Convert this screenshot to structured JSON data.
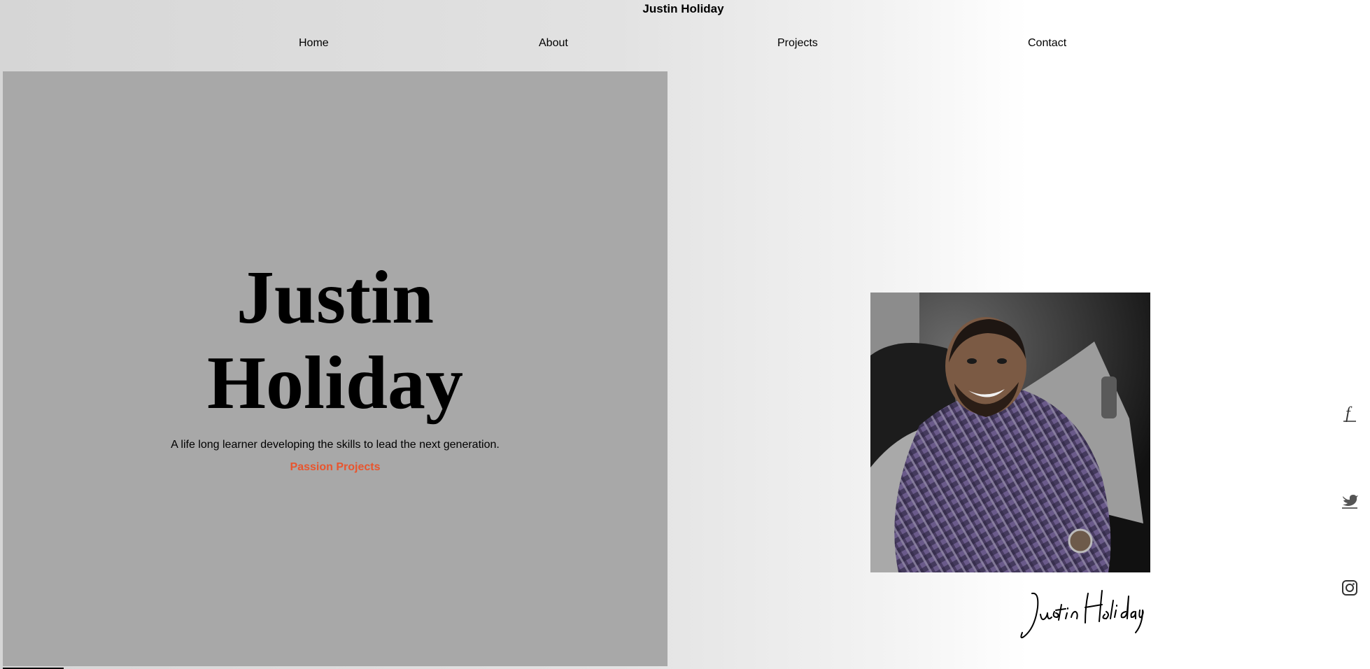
{
  "header": {
    "site_title": "Justin Holiday"
  },
  "nav": {
    "items": [
      {
        "label": "Home"
      },
      {
        "label": "About"
      },
      {
        "label": "Projects"
      },
      {
        "label": "Contact"
      }
    ]
  },
  "hero": {
    "name_line1": "Justin",
    "name_line2": "Holiday",
    "tagline": "A life long learner developing the skills to lead the next generation.",
    "cta_label": "Passion Projects",
    "cta_color": "#e8552e",
    "background_color": "#a8a8a8"
  },
  "profile": {
    "photo": "portrait-photo",
    "signature_text": "Justin Holiday"
  },
  "social": {
    "icons": [
      "facebook-icon",
      "twitter-icon",
      "instagram-icon"
    ]
  }
}
